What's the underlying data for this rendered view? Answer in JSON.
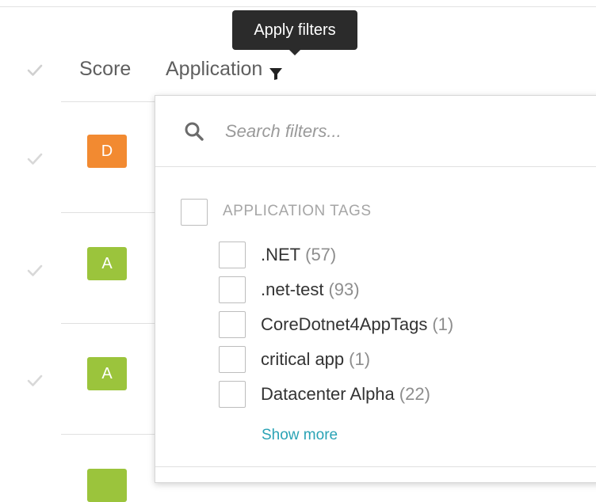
{
  "tooltip": {
    "text": "Apply filters"
  },
  "table": {
    "header": {
      "score_label": "Score",
      "application_label": "Application",
      "filter_icon": "filter-funnel-icon",
      "select_icon": "checkmark-icon"
    },
    "rows": [
      {
        "score": "D",
        "score_color": "#f28a31"
      },
      {
        "score": "A",
        "score_color": "#9bc43c"
      },
      {
        "score": "A",
        "score_color": "#9bc43c"
      },
      {
        "score": "",
        "score_color": "#9bc43c"
      }
    ],
    "row_check_color": "#d0d0d0"
  },
  "filter_panel": {
    "search": {
      "icon": "search-icon",
      "placeholder": "Search filters..."
    },
    "group": {
      "label": "APPLICATION TAGS",
      "items": [
        {
          "name": ".NET",
          "count": "(57)"
        },
        {
          "name": ".net-test",
          "count": "(93)"
        },
        {
          "name": "CoreDotnet4AppTags",
          "count": "(1)"
        },
        {
          "name": "critical app",
          "count": "(1)"
        },
        {
          "name": "Datacenter Alpha",
          "count": "(22)"
        }
      ]
    },
    "show_more_label": "Show more",
    "accent_color": "#2aa3b5"
  }
}
